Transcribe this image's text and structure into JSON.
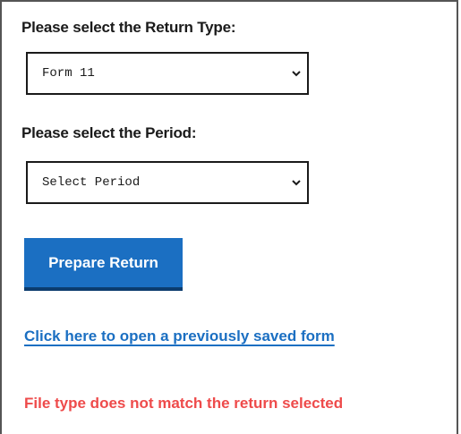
{
  "form": {
    "return_type_label": "Please select the Return Type:",
    "return_type_value": "Form 11",
    "period_label": "Please select the Period:",
    "period_value": "Select Period",
    "prepare_button": "Prepare Return",
    "open_saved_link": "Click here to open a previously saved form",
    "error_message": "File type does not match the return selected"
  },
  "colors": {
    "accent": "#1b6fc2",
    "button_shadow": "#0b3c6e",
    "error": "#ee4b4b",
    "text": "#1a1a1a"
  },
  "icons": {
    "select_caret": "chevron-down-icon"
  }
}
